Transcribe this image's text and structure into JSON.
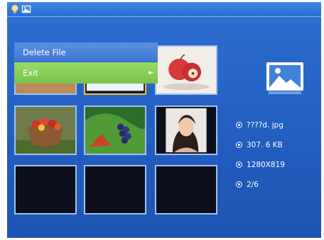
{
  "menu": {
    "items": [
      {
        "label": "Delete File"
      },
      {
        "label": "Exit",
        "has_submenu": true
      }
    ]
  },
  "info": {
    "filename": "????d. jpg",
    "filesize": "307. 6 KB",
    "resolution": "1280X819",
    "index": "2/6"
  },
  "icons": {
    "topbar": [
      "bulb-icon",
      "photo-icon"
    ],
    "panel": "photo-icon"
  },
  "colors": {
    "screen_bg": "#2561c4",
    "highlight": "#79c349",
    "selected_border": "#f0c040"
  }
}
